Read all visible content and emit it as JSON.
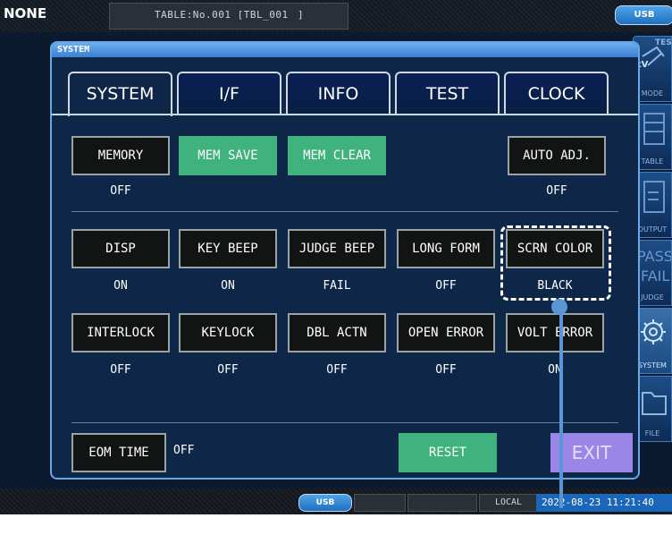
{
  "topbar": {
    "status": "NONE",
    "table_label": "TABLE:No.001 [TBL_001",
    "table_end": "]",
    "usb": "USB"
  },
  "side_panel": [
    {
      "label": "MODE",
      "icon": "test-mode-icon"
    },
    {
      "label": "TABLE",
      "icon": "table-icon"
    },
    {
      "label": "OUTPUT",
      "icon": "output-icon"
    },
    {
      "label": "JUDGE",
      "icon": "judge-icon"
    },
    {
      "label": "SYSTEM",
      "icon": "gear-icon"
    },
    {
      "label": "FILE",
      "icon": "folder-icon"
    }
  ],
  "side_fragments": {
    "mode_top": "TEST",
    "mode_sub": "kV",
    "judge_pass": "PASS",
    "judge_fail": "FAIL"
  },
  "dialog": {
    "title": "SYSTEM",
    "tabs": [
      "SYSTEM",
      "I/F",
      "INFO",
      "TEST",
      "CLOCK"
    ],
    "active_tab": "SYSTEM"
  },
  "row1": {
    "memory": {
      "label": "MEMORY",
      "value": "OFF"
    },
    "mem_save": {
      "label": "MEM SAVE"
    },
    "mem_clear": {
      "label": "MEM CLEAR"
    },
    "auto_adj": {
      "label": "AUTO ADJ.",
      "value": "OFF"
    }
  },
  "row2": [
    {
      "label": "DISP",
      "value": "ON"
    },
    {
      "label": "KEY BEEP",
      "value": "ON"
    },
    {
      "label": "JUDGE BEEP",
      "value": "FAIL"
    },
    {
      "label": "LONG FORM",
      "value": "OFF"
    },
    {
      "label": "SCRN COLOR",
      "value": "BLACK"
    }
  ],
  "row3": [
    {
      "label": "INTERLOCK",
      "value": "OFF"
    },
    {
      "label": "KEYLOCK",
      "value": "OFF"
    },
    {
      "label": "DBL ACTN",
      "value": "OFF"
    },
    {
      "label": "OPEN ERROR",
      "value": "OFF"
    },
    {
      "label": "VOLT ERROR",
      "value": "ON"
    }
  ],
  "bottom_row": {
    "eom_time": {
      "label": "EOM TIME",
      "value": "OFF"
    },
    "reset": "RESET",
    "exit": "EXIT"
  },
  "bottombar": {
    "usb": "USB",
    "local": "LOCAL",
    "datetime": "2022-08-23 11:21:40"
  },
  "colors": {
    "accent_green": "#3fb27e",
    "exit_purple": "#9a86e6",
    "tab_blue": "#0a1f54",
    "dialog_bg": "#0e2748",
    "callout_blue": "#5a96d6"
  }
}
